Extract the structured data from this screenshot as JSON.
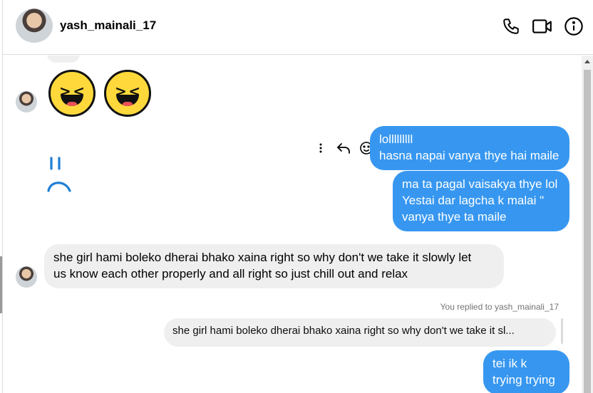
{
  "header": {
    "username": "yash_mainali_17",
    "icons": [
      "phone-icon",
      "video-call-icon",
      "info-icon"
    ]
  },
  "messages": [
    {
      "type": "emoji",
      "from": "them",
      "content": "😆😆",
      "icon": "laughing-emoji"
    },
    {
      "type": "text",
      "from": "me",
      "lines": [
        "lolllllllll",
        "hasna napai vanya thye hai maile"
      ]
    },
    {
      "type": "doodle",
      "from": "them",
      "icon": "sad-face-doodle"
    },
    {
      "type": "text",
      "from": "me",
      "lines": [
        "ma ta pagal vaisakya thye lol",
        "Yestai dar lagcha k malai \"",
        "vanya thye ta maile"
      ]
    },
    {
      "type": "text",
      "from": "them",
      "lines": [
        "she girl hami boleko dherai bhako xaina right so why don't we take it slowly let",
        "us know each other properly and all right so just chill out and relax"
      ]
    },
    {
      "type": "reply",
      "from": "me",
      "note": "You replied to yash_mainali_17",
      "quoted": "she girl hami boleko dherai bhako xaina right so why don't we take it sl..."
    },
    {
      "type": "text",
      "from": "me",
      "lines": [
        "tei ik k",
        "trying trying"
      ]
    }
  ],
  "actions": {
    "icons": [
      "more-options-icon",
      "reply-icon",
      "react-icon"
    ]
  },
  "colors": {
    "outgoing": "#3797f0",
    "incoming": "#efefef",
    "muted": "#737373"
  }
}
